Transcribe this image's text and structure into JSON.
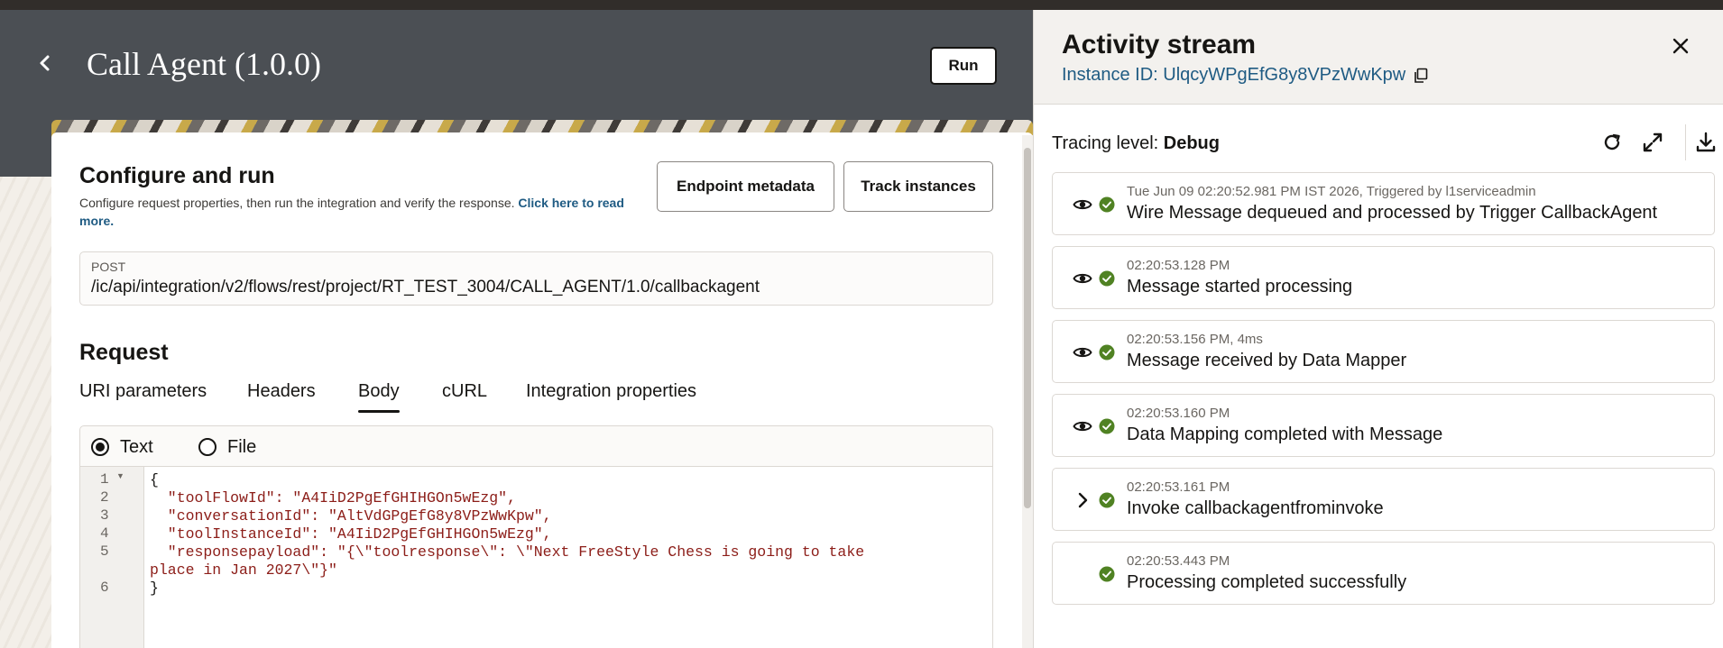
{
  "header": {
    "title": "Call Agent (1.0.0)",
    "run_label": "Run"
  },
  "card": {
    "title": "Configure and run",
    "description": "Configure request properties, then run the integration and verify the response.",
    "link_text": "Click here to read more.",
    "endpoint_metadata_label": "Endpoint metadata",
    "track_instances_label": "Track instances",
    "method": "POST",
    "url": "/ic/api/integration/v2/flows/rest/project/RT_TEST_3004/CALL_AGENT/1.0/callbackagent"
  },
  "request": {
    "title": "Request",
    "tabs": [
      {
        "label": "URI parameters"
      },
      {
        "label": "Headers"
      },
      {
        "label": "Body",
        "active": true
      },
      {
        "label": "cURL"
      },
      {
        "label": "Integration properties"
      }
    ],
    "body_mode": {
      "text_label": "Text",
      "file_label": "File",
      "selected": "Text"
    },
    "code_lines": [
      {
        "num": "1",
        "text": "{"
      },
      {
        "num": "2",
        "text": "  \"toolFlowId\": \"A4IiD2PgEfGHIHGOn5wEzg\","
      },
      {
        "num": "3",
        "text": "  \"conversationId\": \"AltVdGPgEfG8y8VPzWwKpw\","
      },
      {
        "num": "4",
        "text": "  \"toolInstanceId\": \"A4IiD2PgEfGHIHGOn5wEzg\","
      },
      {
        "num": "5",
        "text": "  \"responsepayload\": \"{\\\"toolresponse\\\": \\\"Next FreeStyle Chess is going to take\nplace in Jan 2027\\\"}\""
      },
      {
        "num": "6",
        "text": "}"
      }
    ]
  },
  "activity": {
    "title": "Activity stream",
    "instance_label": "Instance ID: UlqcyWPgEfG8y8VPzWwKpw",
    "tracing_label": "Tracing level:",
    "tracing_value": "Debug",
    "events": [
      {
        "meta": "Tue Jun 09 02:20:52.981 PM IST 2026, Triggered by l1serviceadmin",
        "message": "Wire Message dequeued and processed by Trigger CallbackAgent",
        "lead": "eye-icon"
      },
      {
        "meta": "02:20:53.128 PM",
        "message": "Message started processing",
        "lead": "eye-icon"
      },
      {
        "meta": "02:20:53.156 PM, 4ms",
        "message": "Message received by Data Mapper",
        "lead": "eye-icon"
      },
      {
        "meta": "02:20:53.160 PM",
        "message": "Data Mapping completed with Message",
        "lead": "eye-icon"
      },
      {
        "meta": "02:20:53.161 PM",
        "message": "Invoke callbackagentfrominvoke",
        "lead": "chevron-right-icon"
      },
      {
        "meta": "02:20:53.443 PM",
        "message": "Processing completed successfully",
        "lead": "none"
      }
    ],
    "status_color": "#508223",
    "link_color": "#1f5b83"
  }
}
